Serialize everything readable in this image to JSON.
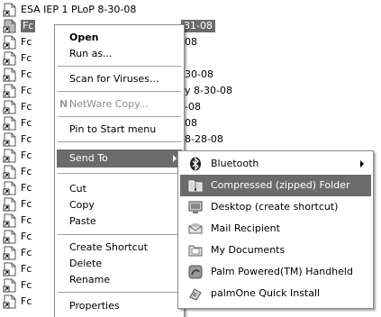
{
  "file_list": {
    "rows": [
      {
        "name": "ESA IEP 1 PLoP 8-30-08",
        "tail": "",
        "selected": false
      },
      {
        "name": "Fc",
        "tail": "31-08",
        "selected": true
      },
      {
        "name": "Fc",
        "tail": "08",
        "selected": false
      },
      {
        "name": "Fc",
        "tail": "30-08",
        "selected": false
      },
      {
        "name": "Fc",
        "tail": "y 8-30-08",
        "selected": false
      },
      {
        "name": "Fc",
        "tail": "-08",
        "selected": false
      },
      {
        "name": "Fc",
        "tail": "08",
        "selected": false
      },
      {
        "name": "Fc",
        "tail": "8-28-08",
        "selected": false
      },
      {
        "name": "Fc",
        "tail": "",
        "selected": false
      },
      {
        "name": "Fc",
        "tail": "",
        "selected": false
      },
      {
        "name": "Fc",
        "tail": "",
        "selected": false
      },
      {
        "name": "Fc",
        "tail": "",
        "selected": false
      },
      {
        "name": "Fc",
        "tail": "",
        "selected": false
      },
      {
        "name": "Fc",
        "tail": "",
        "selected": false
      },
      {
        "name": "Fc",
        "tail": "",
        "selected": false
      },
      {
        "name": "Fc",
        "tail": "",
        "selected": false
      },
      {
        "name": "Fc",
        "tail": "",
        "selected": false
      },
      {
        "name": "Fc",
        "tail": "",
        "selected": false
      },
      {
        "name": "Fc",
        "tail": "",
        "selected": false
      }
    ]
  },
  "context_menu": {
    "open": "Open",
    "run_as": "Run as...",
    "scan_viruses": "Scan for Viruses...",
    "netware_copy": "NetWare Copy...",
    "pin_start": "Pin to Start menu",
    "send_to": "Send To",
    "cut": "Cut",
    "copy": "Copy",
    "paste": "Paste",
    "create_shortcut": "Create Shortcut",
    "delete": "Delete",
    "rename": "Rename",
    "properties": "Properties"
  },
  "send_to_menu": {
    "bluetooth": "Bluetooth",
    "compressed_folder": "Compressed (zipped) Folder",
    "desktop_shortcut": "Desktop (create shortcut)",
    "mail_recipient": "Mail Recipient",
    "my_documents": "My Documents",
    "palm_handheld": "Palm Powered(TM) Handheld",
    "palmone_install": "palmOne Quick Install"
  },
  "colors": {
    "highlight": "#6b6b6b",
    "menu_border": "#8a8a8a",
    "disabled_text": "#8c8c8c"
  }
}
